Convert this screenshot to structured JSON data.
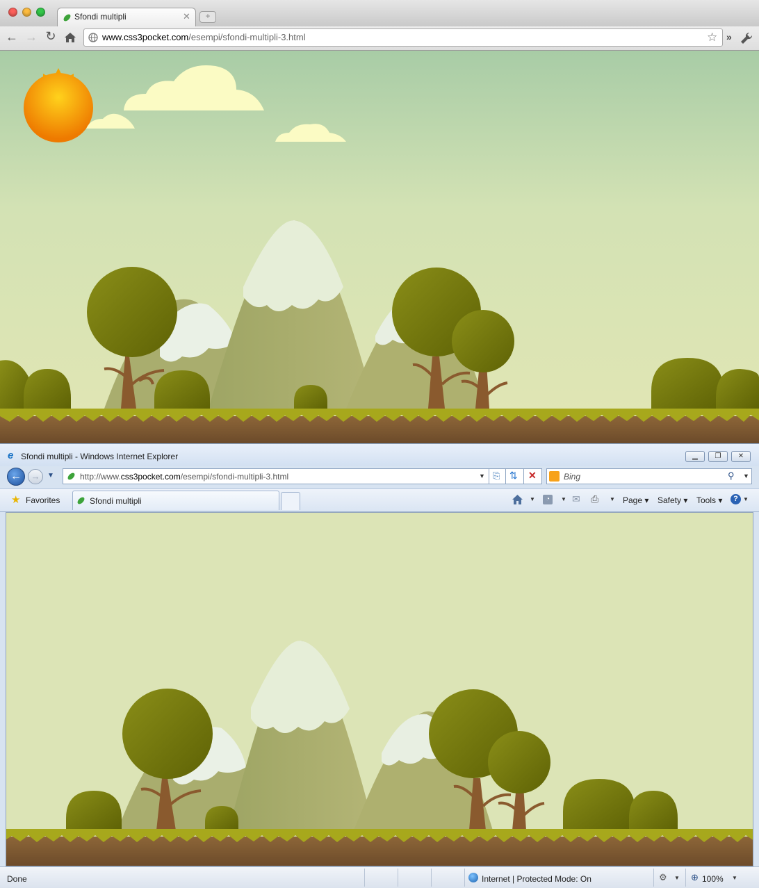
{
  "chrome": {
    "tab_title": "Sfondi multipli",
    "url_host": "www.css3pocket.com",
    "url_path": "/esempi/sfondi-multipli-3.html"
  },
  "ie": {
    "window_title": "Sfondi multipli - Windows Internet Explorer",
    "url_prefix": "http://www.",
    "url_host": "css3pocket.com",
    "url_path": "/esempi/sfondi-multipli-3.html",
    "search_placeholder": "Bing",
    "favorites_label": "Favorites",
    "tab_title": "Sfondi multipli",
    "cmd": {
      "page": "Page",
      "safety": "Safety",
      "tools": "Tools"
    },
    "status": {
      "left": "Done",
      "zone": "Internet | Protected Mode: On",
      "zoom": "100%"
    }
  },
  "colors": {
    "sky_top": "#a8cca6",
    "sky_bottom": "#e2e6b4",
    "ie_background": "#dce4b6",
    "mountain": "#a7ad6e",
    "snow": "#e8f0e0",
    "tree_foliage": "#7a7f10",
    "trunk": "#8a5a2e",
    "grass": "#a8a81c",
    "soil": "#7a5632",
    "sun": "#f5a000",
    "cloud": "#fdfdc8"
  },
  "icons": [
    "back-icon",
    "forward-icon",
    "reload-icon",
    "home-icon",
    "globe-icon",
    "star-icon",
    "wrench-icon",
    "leaf-favicon-icon",
    "ie-logo-icon",
    "search-icon",
    "rss-icon",
    "mail-icon",
    "print-icon",
    "help-icon"
  ]
}
